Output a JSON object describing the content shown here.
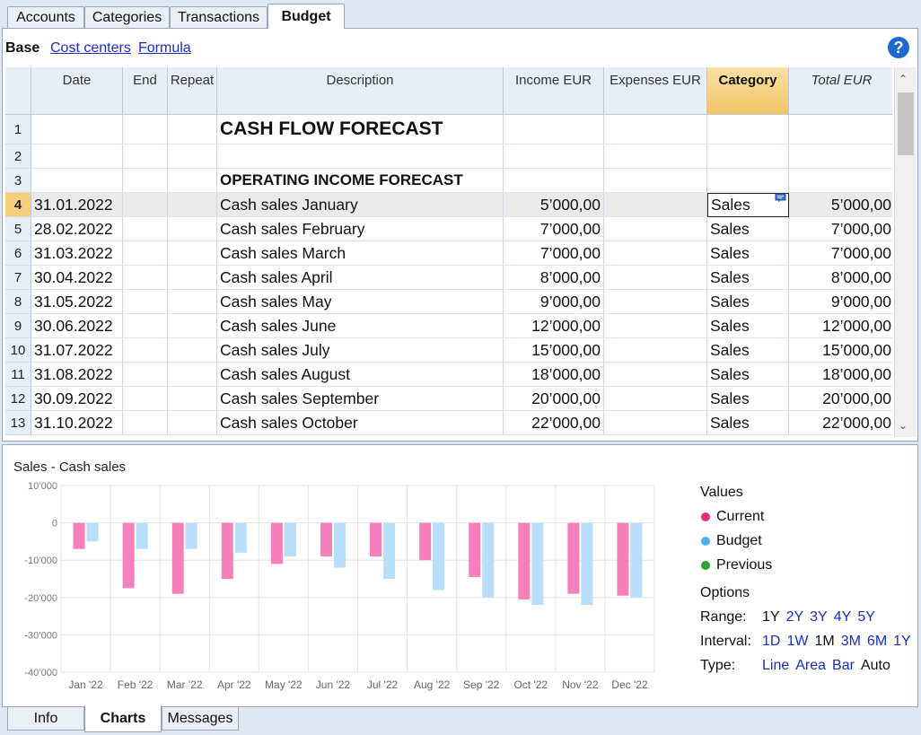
{
  "top_tabs": [
    {
      "label": "Accounts"
    },
    {
      "label": "Categories"
    },
    {
      "label": "Transactions"
    },
    {
      "label": "Budget"
    }
  ],
  "views": {
    "base": "Base",
    "cost_centers": "Cost centers",
    "formula": "Formula"
  },
  "help_icon": "?",
  "columns": {
    "date": "Date",
    "end": "End",
    "repeat": "Repeat",
    "description": "Description",
    "income": "Income EUR",
    "expenses": "Expenses EUR",
    "category": "Category",
    "total": "Total EUR"
  },
  "rows": [
    {
      "n": "1",
      "date": "",
      "desc": "CASH FLOW FORECAST",
      "income": "",
      "category": "",
      "total": "",
      "style": "title1"
    },
    {
      "n": "2",
      "date": "",
      "desc": "",
      "income": "",
      "category": "",
      "total": ""
    },
    {
      "n": "3",
      "date": "",
      "desc": "OPERATING INCOME FORECAST",
      "income": "",
      "category": "",
      "total": "",
      "style": "title2"
    },
    {
      "n": "4",
      "date": "31.01.2022",
      "desc": "Cash sales January",
      "income": "5’000,00",
      "category": "Sales",
      "total": "5’000,00",
      "current": true
    },
    {
      "n": "5",
      "date": "28.02.2022",
      "desc": "Cash sales February",
      "income": "7’000,00",
      "category": "Sales",
      "total": "7’000,00"
    },
    {
      "n": "6",
      "date": "31.03.2022",
      "desc": "Cash sales March",
      "income": "7’000,00",
      "category": "Sales",
      "total": "7’000,00"
    },
    {
      "n": "7",
      "date": "30.04.2022",
      "desc": "Cash sales April",
      "income": "8’000,00",
      "category": "Sales",
      "total": "8’000,00"
    },
    {
      "n": "8",
      "date": "31.05.2022",
      "desc": "Cash sales May",
      "income": "9’000,00",
      "category": "Sales",
      "total": "9’000,00"
    },
    {
      "n": "9",
      "date": "30.06.2022",
      "desc": "Cash sales June",
      "income": "12’000,00",
      "category": "Sales",
      "total": "12’000,00"
    },
    {
      "n": "10",
      "date": "31.07.2022",
      "desc": "Cash sales July",
      "income": "15’000,00",
      "category": "Sales",
      "total": "15’000,00"
    },
    {
      "n": "11",
      "date": "31.08.2022",
      "desc": "Cash sales August",
      "income": "18’000,00",
      "category": "Sales",
      "total": "18’000,00"
    },
    {
      "n": "12",
      "date": "30.09.2022",
      "desc": "Cash sales September",
      "income": "20’000,00",
      "category": "Sales",
      "total": "20’000,00"
    },
    {
      "n": "13",
      "date": "31.10.2022",
      "desc": "Cash sales October",
      "income": "22’000,00",
      "category": "Sales",
      "total": "22’000,00"
    }
  ],
  "chart_data": {
    "type": "bar",
    "title": "Sales - Cash sales",
    "categories": [
      "Jan '22",
      "Feb '22",
      "Mar '22",
      "Apr '22",
      "May '22",
      "Jun '22",
      "Jul '22",
      "Aug '22",
      "Sep '22",
      "Oct '22",
      "Nov '22",
      "Dec '22"
    ],
    "y_ticks": [
      "10’000",
      "0",
      "-10’000",
      "-20’000",
      "-30’000",
      "-40’000"
    ],
    "ylim": [
      -40000,
      10000
    ],
    "series": [
      {
        "name": "Current",
        "color": "#f77fba",
        "values": [
          -7000,
          -17500,
          -19000,
          -15000,
          -11000,
          -9000,
          -9000,
          -10000,
          -14500,
          -20500,
          -19000,
          -19500
        ]
      },
      {
        "name": "Budget",
        "color": "#b9defb",
        "values": [
          -5000,
          -7000,
          -7000,
          -8000,
          -9000,
          -12000,
          -15000,
          -18000,
          -20000,
          -22000,
          -22000,
          -20000
        ]
      }
    ],
    "grid": true
  },
  "legend": {
    "heading": "Values",
    "items": [
      {
        "label": "Current",
        "color": "#f0287e"
      },
      {
        "label": "Budget",
        "color": "#4fb1f2"
      },
      {
        "label": "Previous",
        "color": "#2aa52f"
      }
    ]
  },
  "options": {
    "heading": "Options",
    "range_label": "Range:",
    "range": [
      {
        "t": "1Y",
        "cur": true
      },
      {
        "t": "2Y"
      },
      {
        "t": "3Y"
      },
      {
        "t": "4Y"
      },
      {
        "t": "5Y"
      }
    ],
    "interval_label": "Interval:",
    "interval": [
      {
        "t": "1D"
      },
      {
        "t": "1W"
      },
      {
        "t": "1M",
        "cur": true
      },
      {
        "t": "3M"
      },
      {
        "t": "6M"
      },
      {
        "t": "1Y"
      }
    ],
    "type_label": "Type:",
    "type": [
      {
        "t": "Line"
      },
      {
        "t": "Area"
      },
      {
        "t": "Bar"
      },
      {
        "t": "Auto",
        "cur": true
      }
    ]
  },
  "bottom_tabs": [
    {
      "label": "Info"
    },
    {
      "label": "Charts"
    },
    {
      "label": "Messages"
    }
  ]
}
